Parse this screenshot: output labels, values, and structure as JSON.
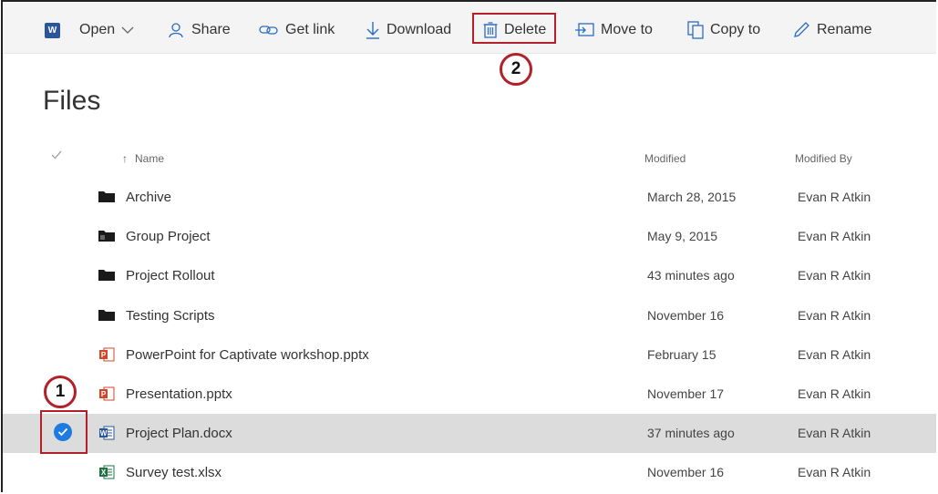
{
  "toolbar": {
    "app_icon": "word-icon",
    "open_label": "Open",
    "share_label": "Share",
    "getlink_label": "Get link",
    "download_label": "Download",
    "delete_label": "Delete",
    "moveto_label": "Move to",
    "copyto_label": "Copy to",
    "rename_label": "Rename"
  },
  "page": {
    "title": "Files"
  },
  "columns": {
    "name": "Name",
    "modified": "Modified",
    "modified_by": "Modified By"
  },
  "callouts": {
    "one": "1",
    "two": "2"
  },
  "rows": [
    {
      "type": "folder",
      "name": "Archive",
      "modified": "March 28, 2015",
      "modified_by": "Evan R Atkin"
    },
    {
      "type": "shared-folder",
      "name": "Group Project",
      "modified": "May 9, 2015",
      "modified_by": "Evan R Atkin"
    },
    {
      "type": "folder",
      "name": "Project Rollout",
      "modified": "43 minutes ago",
      "modified_by": "Evan R Atkin"
    },
    {
      "type": "folder",
      "name": "Testing Scripts",
      "modified": "November 16",
      "modified_by": "Evan R Atkin"
    },
    {
      "type": "pptx",
      "name": "PowerPoint for Captivate workshop.pptx",
      "modified": "February 15",
      "modified_by": "Evan R Atkin"
    },
    {
      "type": "pptx",
      "name": "Presentation.pptx",
      "modified": "November 17",
      "modified_by": "Evan R Atkin"
    },
    {
      "type": "docx",
      "name": "Project Plan.docx",
      "modified": "37 minutes ago",
      "modified_by": "Evan R Atkin",
      "selected": true
    },
    {
      "type": "xlsx",
      "name": "Survey test.xlsx",
      "modified": "November 16",
      "modified_by": "Evan R Atkin"
    }
  ],
  "colors": {
    "accent_blue": "#1e7be0",
    "highlight_red": "#b3202a",
    "word": "#2b579a",
    "powerpoint": "#d24726",
    "excel": "#217346"
  }
}
